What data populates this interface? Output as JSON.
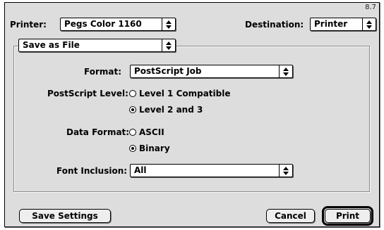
{
  "window": {
    "version": "8.7"
  },
  "top_bar": {
    "printer_label": "Printer:",
    "printer_value": "Pegs Color 1160",
    "destination_label": "Destination:",
    "destination_value": "Printer"
  },
  "panel": {
    "section_popup_value": "Save as File",
    "format_label": "Format:",
    "format_value": "PostScript Job",
    "postscript_level_label": "PostScript Level:",
    "postscript_level_options": [
      {
        "label": "Level 1 Compatible",
        "selected": false
      },
      {
        "label": "Level 2 and 3",
        "selected": true
      }
    ],
    "data_format_label": "Data Format:",
    "data_format_options": [
      {
        "label": "ASCII",
        "selected": false
      },
      {
        "label": "Binary",
        "selected": true
      }
    ],
    "font_inclusion_label": "Font Inclusion:",
    "font_inclusion_value": "All"
  },
  "buttons": {
    "save_settings": "Save Settings",
    "cancel": "Cancel",
    "print": "Print"
  }
}
